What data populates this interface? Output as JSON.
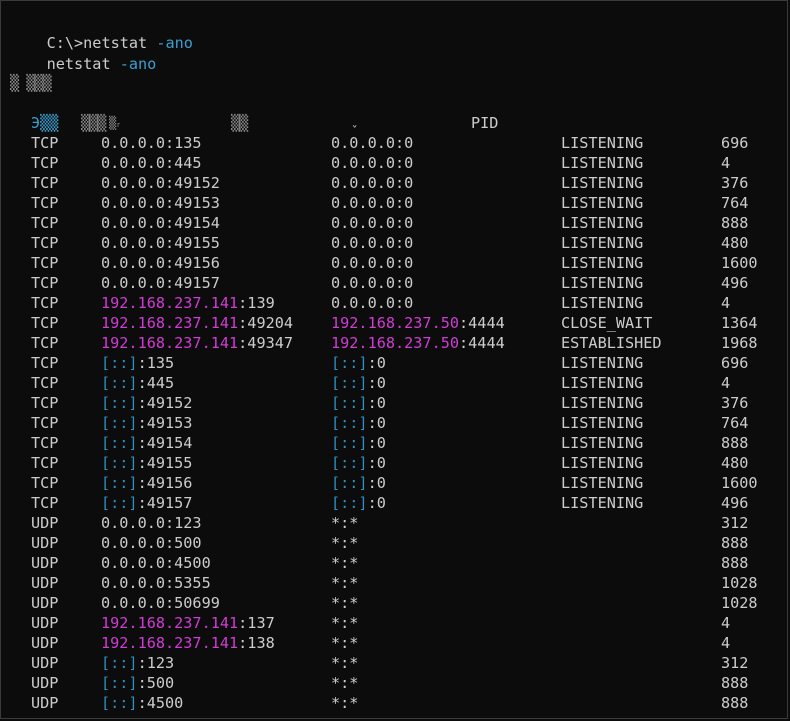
{
  "colors": {
    "background": "#0c0c0c",
    "text": "#cccccc",
    "arg": "#3b9fd0",
    "ipv4": "#d23bd6",
    "ipv6_bracket": "#2e8fc0"
  },
  "prompt": {
    "path": "C:\\>",
    "cmd": "netstat",
    "arg": " -ano"
  },
  "echo": {
    "cmd": "netstat",
    "arg": " -ano"
  },
  "section_title": "▒ ▒▒▒",
  "header": {
    "proto": "Э▒▒",
    "local": "▒▒▒ ",
    "foreign": "▒▒",
    "pid": "PID",
    "foreign_mark": "ˇ",
    "local_mark": "▒ᵣ"
  },
  "rows": [
    {
      "proto": "TCP",
      "lip": "",
      "lb": "",
      "lport": "0.0.0.0:135",
      "fip": "",
      "fb": "",
      "fport": "0.0.0.0:0",
      "state": "LISTENING",
      "pid": "696"
    },
    {
      "proto": "TCP",
      "lip": "",
      "lb": "",
      "lport": "0.0.0.0:445",
      "fip": "",
      "fb": "",
      "fport": "0.0.0.0:0",
      "state": "LISTENING",
      "pid": "4"
    },
    {
      "proto": "TCP",
      "lip": "",
      "lb": "",
      "lport": "0.0.0.0:49152",
      "fip": "",
      "fb": "",
      "fport": "0.0.0.0:0",
      "state": "LISTENING",
      "pid": "376"
    },
    {
      "proto": "TCP",
      "lip": "",
      "lb": "",
      "lport": "0.0.0.0:49153",
      "fip": "",
      "fb": "",
      "fport": "0.0.0.0:0",
      "state": "LISTENING",
      "pid": "764"
    },
    {
      "proto": "TCP",
      "lip": "",
      "lb": "",
      "lport": "0.0.0.0:49154",
      "fip": "",
      "fb": "",
      "fport": "0.0.0.0:0",
      "state": "LISTENING",
      "pid": "888"
    },
    {
      "proto": "TCP",
      "lip": "",
      "lb": "",
      "lport": "0.0.0.0:49155",
      "fip": "",
      "fb": "",
      "fport": "0.0.0.0:0",
      "state": "LISTENING",
      "pid": "480"
    },
    {
      "proto": "TCP",
      "lip": "",
      "lb": "",
      "lport": "0.0.0.0:49156",
      "fip": "",
      "fb": "",
      "fport": "0.0.0.0:0",
      "state": "LISTENING",
      "pid": "1600"
    },
    {
      "proto": "TCP",
      "lip": "",
      "lb": "",
      "lport": "0.0.0.0:49157",
      "fip": "",
      "fb": "",
      "fport": "0.0.0.0:0",
      "state": "LISTENING",
      "pid": "496"
    },
    {
      "proto": "TCP",
      "lip": "192.168.237.141",
      "lb": "",
      "lport": ":139",
      "fip": "",
      "fb": "",
      "fport": "0.0.0.0:0",
      "state": "LISTENING",
      "pid": "4"
    },
    {
      "proto": "TCP",
      "lip": "192.168.237.141",
      "lb": "",
      "lport": ":49204",
      "fip": "192.168.237.50",
      "fb": "",
      "fport": ":4444",
      "state": "CLOSE_WAIT",
      "pid": "1364"
    },
    {
      "proto": "TCP",
      "lip": "192.168.237.141",
      "lb": "",
      "lport": ":49347",
      "fip": "192.168.237.50",
      "fb": "",
      "fport": ":4444",
      "state": "ESTABLISHED",
      "pid": "1968"
    },
    {
      "proto": "TCP",
      "lip": "",
      "lb": "[::]",
      "lport": ":135",
      "fip": "",
      "fb": "[::]",
      "fport": ":0",
      "state": "LISTENING",
      "pid": "696"
    },
    {
      "proto": "TCP",
      "lip": "",
      "lb": "[::]",
      "lport": ":445",
      "fip": "",
      "fb": "[::]",
      "fport": ":0",
      "state": "LISTENING",
      "pid": "4"
    },
    {
      "proto": "TCP",
      "lip": "",
      "lb": "[::]",
      "lport": ":49152",
      "fip": "",
      "fb": "[::]",
      "fport": ":0",
      "state": "LISTENING",
      "pid": "376"
    },
    {
      "proto": "TCP",
      "lip": "",
      "lb": "[::]",
      "lport": ":49153",
      "fip": "",
      "fb": "[::]",
      "fport": ":0",
      "state": "LISTENING",
      "pid": "764"
    },
    {
      "proto": "TCP",
      "lip": "",
      "lb": "[::]",
      "lport": ":49154",
      "fip": "",
      "fb": "[::]",
      "fport": ":0",
      "state": "LISTENING",
      "pid": "888"
    },
    {
      "proto": "TCP",
      "lip": "",
      "lb": "[::]",
      "lport": ":49155",
      "fip": "",
      "fb": "[::]",
      "fport": ":0",
      "state": "LISTENING",
      "pid": "480"
    },
    {
      "proto": "TCP",
      "lip": "",
      "lb": "[::]",
      "lport": ":49156",
      "fip": "",
      "fb": "[::]",
      "fport": ":0",
      "state": "LISTENING",
      "pid": "1600"
    },
    {
      "proto": "TCP",
      "lip": "",
      "lb": "[::]",
      "lport": ":49157",
      "fip": "",
      "fb": "[::]",
      "fport": ":0",
      "state": "LISTENING",
      "pid": "496"
    },
    {
      "proto": "UDP",
      "lip": "",
      "lb": "",
      "lport": "0.0.0.0:123",
      "fip": "",
      "fb": "",
      "fport": "*:*",
      "state": "",
      "pid": "312"
    },
    {
      "proto": "UDP",
      "lip": "",
      "lb": "",
      "lport": "0.0.0.0:500",
      "fip": "",
      "fb": "",
      "fport": "*:*",
      "state": "",
      "pid": "888"
    },
    {
      "proto": "UDP",
      "lip": "",
      "lb": "",
      "lport": "0.0.0.0:4500",
      "fip": "",
      "fb": "",
      "fport": "*:*",
      "state": "",
      "pid": "888"
    },
    {
      "proto": "UDP",
      "lip": "",
      "lb": "",
      "lport": "0.0.0.0:5355",
      "fip": "",
      "fb": "",
      "fport": "*:*",
      "state": "",
      "pid": "1028"
    },
    {
      "proto": "UDP",
      "lip": "",
      "lb": "",
      "lport": "0.0.0.0:50699",
      "fip": "",
      "fb": "",
      "fport": "*:*",
      "state": "",
      "pid": "1028"
    },
    {
      "proto": "UDP",
      "lip": "192.168.237.141",
      "lb": "",
      "lport": ":137",
      "fip": "",
      "fb": "",
      "fport": "*:*",
      "state": "",
      "pid": "4"
    },
    {
      "proto": "UDP",
      "lip": "192.168.237.141",
      "lb": "",
      "lport": ":138",
      "fip": "",
      "fb": "",
      "fport": "*:*",
      "state": "",
      "pid": "4"
    },
    {
      "proto": "UDP",
      "lip": "",
      "lb": "[::]",
      "lport": ":123",
      "fip": "",
      "fb": "",
      "fport": "*:*",
      "state": "",
      "pid": "312"
    },
    {
      "proto": "UDP",
      "lip": "",
      "lb": "[::]",
      "lport": ":500",
      "fip": "",
      "fb": "",
      "fport": "*:*",
      "state": "",
      "pid": "888"
    },
    {
      "proto": "UDP",
      "lip": "",
      "lb": "[::]",
      "lport": ":4500",
      "fip": "",
      "fb": "",
      "fport": "*:*",
      "state": "",
      "pid": "888"
    }
  ]
}
